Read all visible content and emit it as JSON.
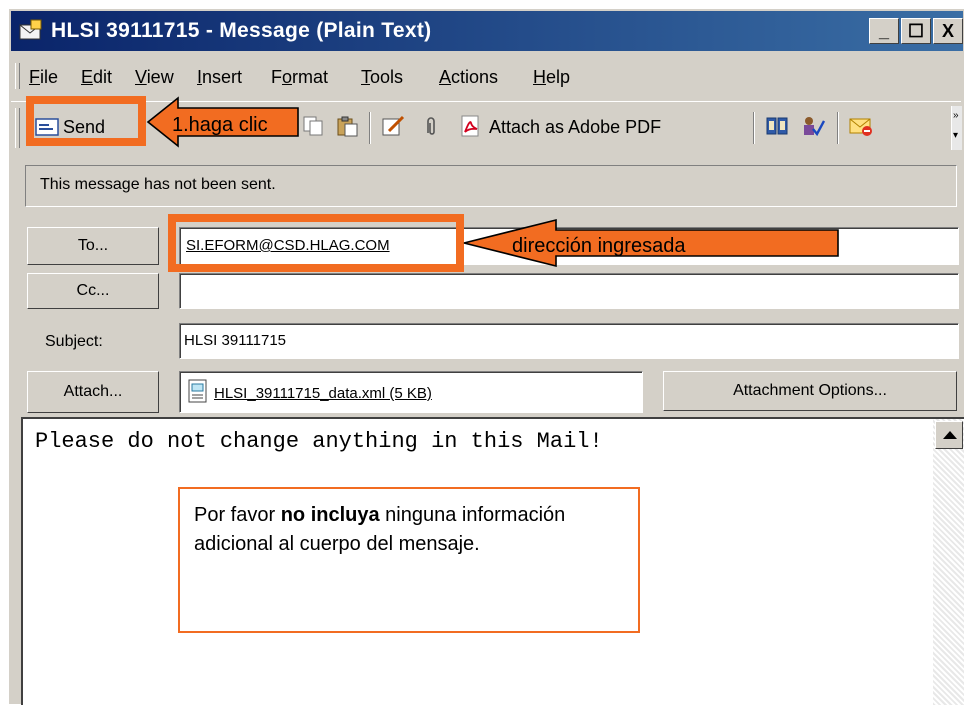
{
  "window": {
    "title": "HLSI 39111715 - Message (Plain Text)",
    "controls": {
      "minimize": "_",
      "maximize": "☐",
      "close": "X"
    }
  },
  "menu": [
    "File",
    "Edit",
    "View",
    "Insert",
    "Format",
    "Tools",
    "Actions",
    "Help"
  ],
  "menu_mnemonics": [
    "F",
    "E",
    "V",
    "I",
    "o",
    "T",
    "A",
    "H"
  ],
  "toolbar": {
    "send_label": "Send",
    "attach_pdf_label": "Attach as Adobe PDF",
    "icons": [
      "send-icon",
      "cut-icon",
      "copy-icon",
      "paste-icon",
      "edit-icon",
      "paperclip-icon",
      "pdf-icon",
      "address-book-icon",
      "check-names-icon",
      "options-icon"
    ]
  },
  "info_bar": {
    "text": "This message has not been sent."
  },
  "fields": {
    "to_button": "To...",
    "to_value": "SI.EFORM@CSD.HLAG.COM",
    "cc_button": "Cc...",
    "cc_value": "",
    "subject_label": "Subject:",
    "subject_value": "HLSI 39111715",
    "attach_button": "Attach...",
    "attachment_name": "HLSI_39111715_data.xml (5 KB)",
    "attachment_options_button": "Attachment Options..."
  },
  "body": {
    "text": "Please do not change anything in this Mail!"
  },
  "annotations": {
    "click_label": "1.haga clic",
    "address_label": "dirección ingresada",
    "note_part1": "Por favor ",
    "note_bold": "no incluya",
    "note_part2": " ninguna información adicional al cuerpo del mensaje.",
    "color": "#f26c21"
  }
}
